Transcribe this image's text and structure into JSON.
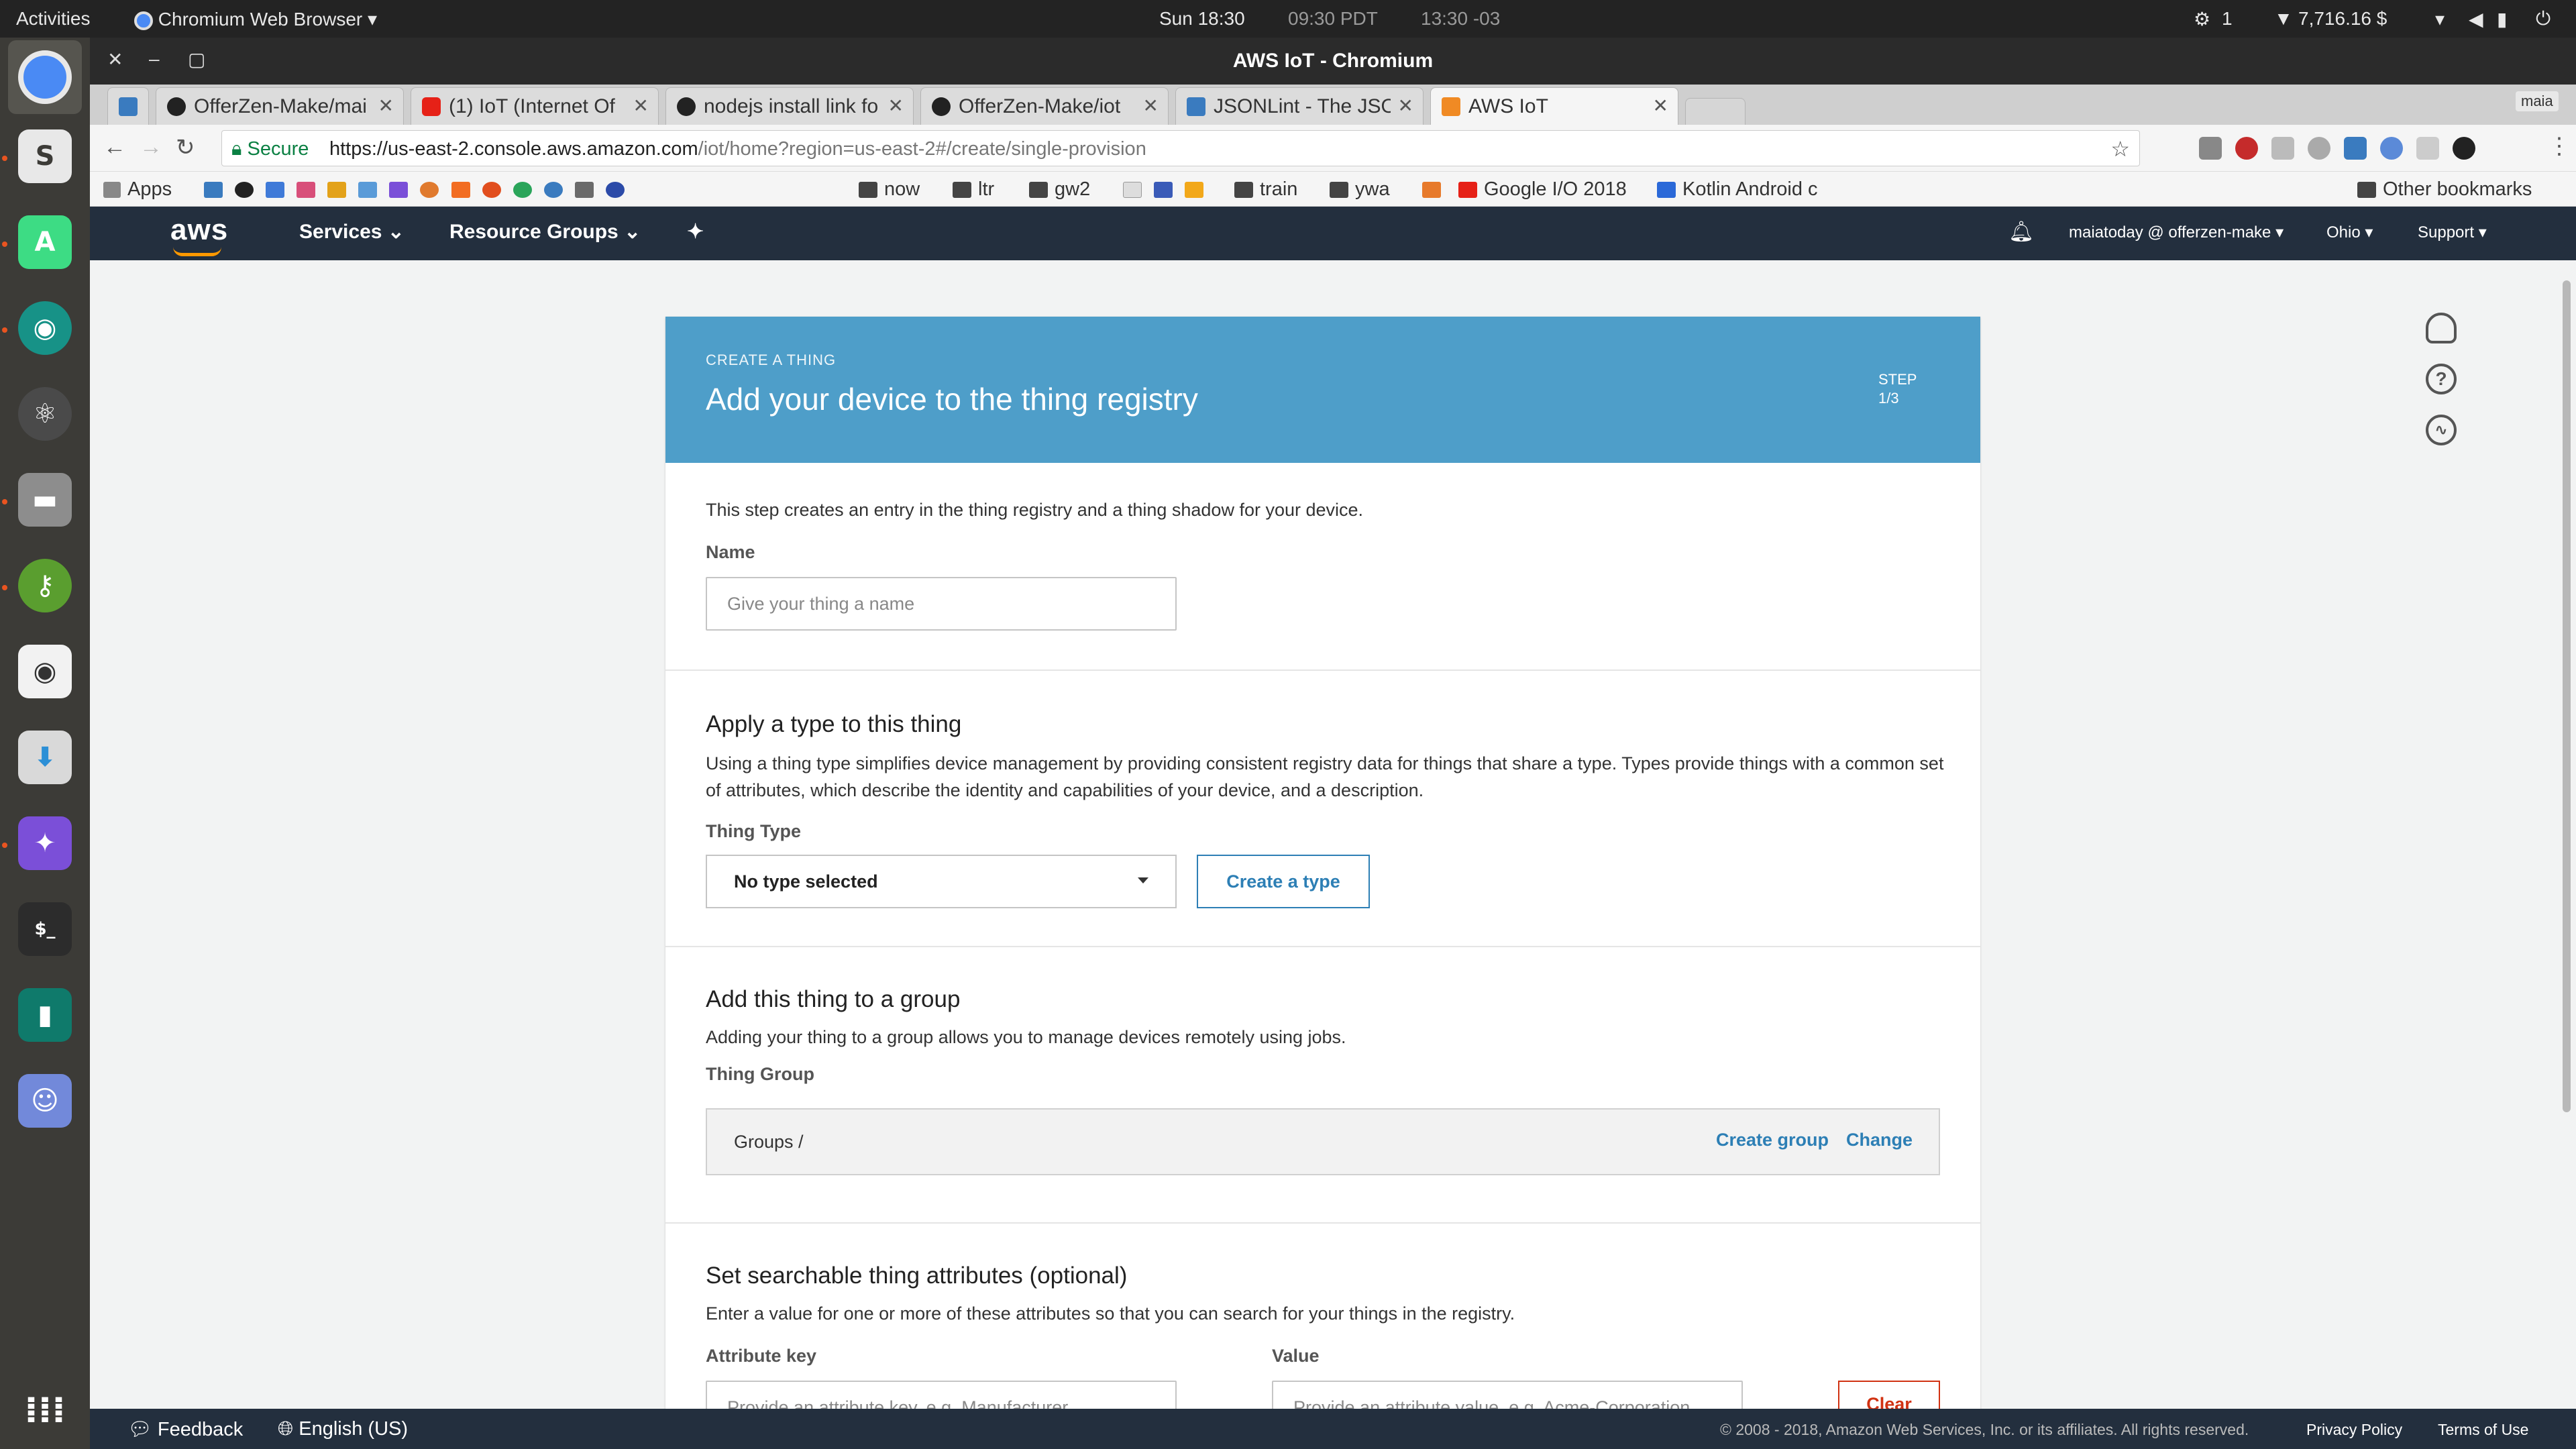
{
  "topbar": {
    "activities": "Activities",
    "app_menu": "Chromium Web Browser",
    "clock": "Sun 18:30",
    "clock_pdt": "09:30 PDT",
    "clock_brt": "13:30 -03",
    "indicator_count": "1",
    "balance": "7,716.16 $"
  },
  "window": {
    "title": "AWS IoT - Chromium",
    "profile": "maia"
  },
  "tabs": [
    {
      "label": "OfferZen-Make/mai",
      "color": "#222"
    },
    {
      "label": "(1) IoT (Internet Of",
      "color": "#e62117"
    },
    {
      "label": "nodejs install link fo",
      "color": "#222"
    },
    {
      "label": "OfferZen-Make/iot",
      "color": "#222"
    },
    {
      "label": "JSONLint - The JSO",
      "color": "#3a7bbf"
    },
    {
      "label": "AWS IoT",
      "color": "#f08a24"
    }
  ],
  "address": {
    "secure_label": "Secure",
    "url_host": "https://us-east-2.console.aws.amazon.com",
    "url_path": "/iot/home?region=us-east-2#/create/single-provision"
  },
  "bookmarks": [
    {
      "label": "Apps"
    },
    {
      "label": "now"
    },
    {
      "label": "ltr"
    },
    {
      "label": "gw2"
    },
    {
      "label": "train"
    },
    {
      "label": "ywa"
    },
    {
      "label": "Google I/O 2018"
    },
    {
      "label": "Kotlin Android c"
    },
    {
      "label": "Other bookmarks"
    }
  ],
  "aws_nav": {
    "logo": "aws",
    "services": "Services",
    "resource_groups": "Resource Groups",
    "account": "maiatoday @ offerzen-make",
    "region": "Ohio",
    "support": "Support"
  },
  "wizard": {
    "eyebrow": "CREATE A THING",
    "title": "Add your device to the thing registry",
    "step_label": "STEP",
    "step_value": "1/3",
    "intro": "This step creates an entry in the thing registry and a thing shadow for your device.",
    "name_label": "Name",
    "name_placeholder": "Give your thing a name",
    "type_heading": "Apply a type to this thing",
    "type_desc": "Using a thing type simplifies device management by providing consistent registry data for things that share a type. Types provide things with a common set of attributes, which describe the identity and capabilities of your device, and a description.",
    "type_label": "Thing Type",
    "type_value": "No type selected",
    "create_type": "Create a type",
    "group_heading": "Add this thing to a group",
    "group_desc": "Adding your thing to a group allows you to manage devices remotely using jobs.",
    "group_label": "Thing Group",
    "group_path": "Groups /",
    "create_group": "Create group",
    "change": "Change",
    "attr_heading": "Set searchable thing attributes (optional)",
    "attr_desc": "Enter a value for one or more of these attributes so that you can search for your things in the registry.",
    "attr_key_label": "Attribute key",
    "attr_key_placeholder": "Provide an attribute key, e.g. Manufacturer",
    "value_label": "Value",
    "value_placeholder": "Provide an attribute value, e.g. Acme-Corporation",
    "clear": "Clear"
  },
  "footer": {
    "feedback": "Feedback",
    "language": "English (US)",
    "copyright": "© 2008 - 2018, Amazon Web Services, Inc. or its affiliates. All rights reserved.",
    "privacy": "Privacy Policy",
    "terms": "Terms of Use"
  },
  "colors": {
    "aws_nav": "#232f3e",
    "wizard_header": "#4e9ec9",
    "link": "#2d7fb5",
    "danger": "#d13212"
  }
}
